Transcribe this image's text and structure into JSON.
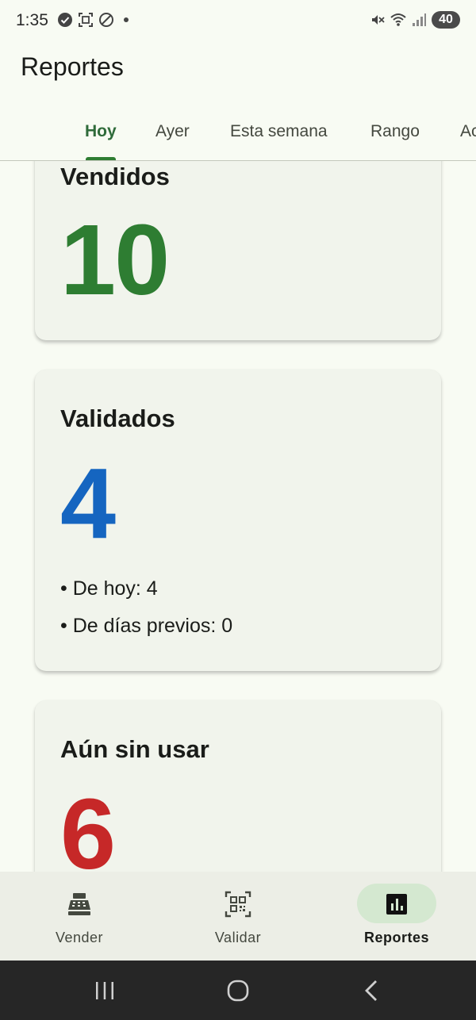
{
  "status_bar": {
    "time": "1:35",
    "battery": "40",
    "icons_left": [
      "check-circle-icon",
      "screenshot-icon",
      "do-not-disturb-icon",
      "notification-dot-icon"
    ],
    "icons_right": [
      "mute-icon",
      "wifi-icon",
      "signal-icon",
      "battery-icon"
    ]
  },
  "app_bar": {
    "title": "Reportes"
  },
  "tabs": [
    {
      "label": "Hoy",
      "active": true
    },
    {
      "label": "Ayer",
      "active": false
    },
    {
      "label": "Esta semana",
      "active": false
    },
    {
      "label": "Rango",
      "active": false
    },
    {
      "label": "Ac",
      "active": false
    }
  ],
  "cards": {
    "vendidos": {
      "title": "Vendidos",
      "value": "10",
      "color": "#2e7d32"
    },
    "validados": {
      "title": "Validados",
      "value": "4",
      "color": "#1565c0",
      "details": [
        "• De hoy: 4",
        "• De días previos: 0"
      ]
    },
    "sin_usar": {
      "title": "Aún sin usar",
      "value": "6",
      "color": "#c62828"
    }
  },
  "bottom_nav": [
    {
      "label": "Vender",
      "icon": "cash-register-icon",
      "active": false
    },
    {
      "label": "Validar",
      "icon": "qr-code-scan-icon",
      "active": false
    },
    {
      "label": "Reportes",
      "icon": "bar-chart-icon",
      "active": true
    }
  ],
  "system_nav": [
    "recent-apps-icon",
    "home-icon",
    "back-icon"
  ],
  "colors": {
    "background": "#f8fbf3",
    "card": "#f1f4ec",
    "accent": "#2e7d32",
    "nav_active_pill": "#d4e8d0"
  }
}
